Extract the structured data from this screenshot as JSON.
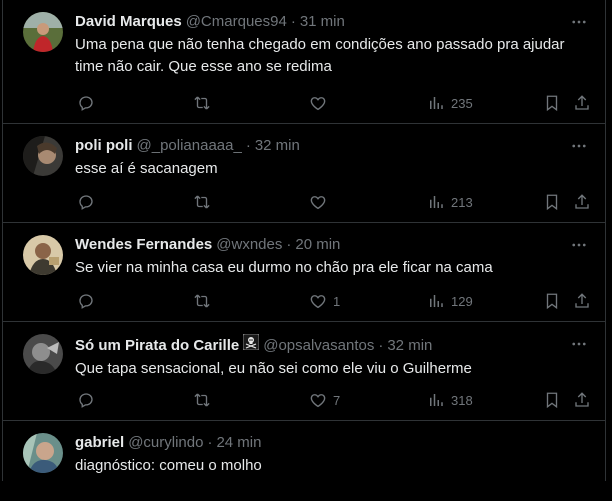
{
  "colors": {
    "background": "#000000",
    "divider": "#2f3336",
    "text": "#e7e9ea",
    "muted": "#71767b"
  },
  "tweets": [
    {
      "name": "David Marques",
      "handle": "@Cmarques94",
      "dot": "·",
      "time": "31 min",
      "text": "Uma pena que não tenha chegado em condições ano passado pra ajudar time não cair. Que esse ano se redima",
      "likes": "",
      "views": "235",
      "avatar_icon": "avatar-red-shirt"
    },
    {
      "name": "poli poli",
      "handle": "@_polianaaaa_",
      "dot": "·",
      "time": "32 min",
      "text": "esse aí é sacanagem",
      "likes": "",
      "views": "213",
      "avatar_icon": "avatar-gray"
    },
    {
      "name": "Wendes Fernandes",
      "handle": "@wxndes",
      "dot": "·",
      "time": "20 min",
      "text": "Se vier na minha casa eu durmo no chão pra ele ficar na cama",
      "likes": "1",
      "views": "129",
      "avatar_icon": "avatar-beige"
    },
    {
      "name": "Só um Pirata do Carille",
      "name_emoji": "pirate-flag-icon",
      "handle": "@opsalvasantos",
      "dot": "·",
      "time": "32 min",
      "text": "Que tapa sensacional, eu não sei como ele viu o Guilherme",
      "likes": "7",
      "views": "318",
      "avatar_icon": "avatar-dark-gray"
    },
    {
      "name": "gabriel",
      "handle": "@curylindo",
      "dot": "·",
      "time": "24 min",
      "text": "diagnóstico: comeu o molho",
      "likes": "",
      "views": "",
      "avatar_icon": "avatar-teal"
    }
  ]
}
